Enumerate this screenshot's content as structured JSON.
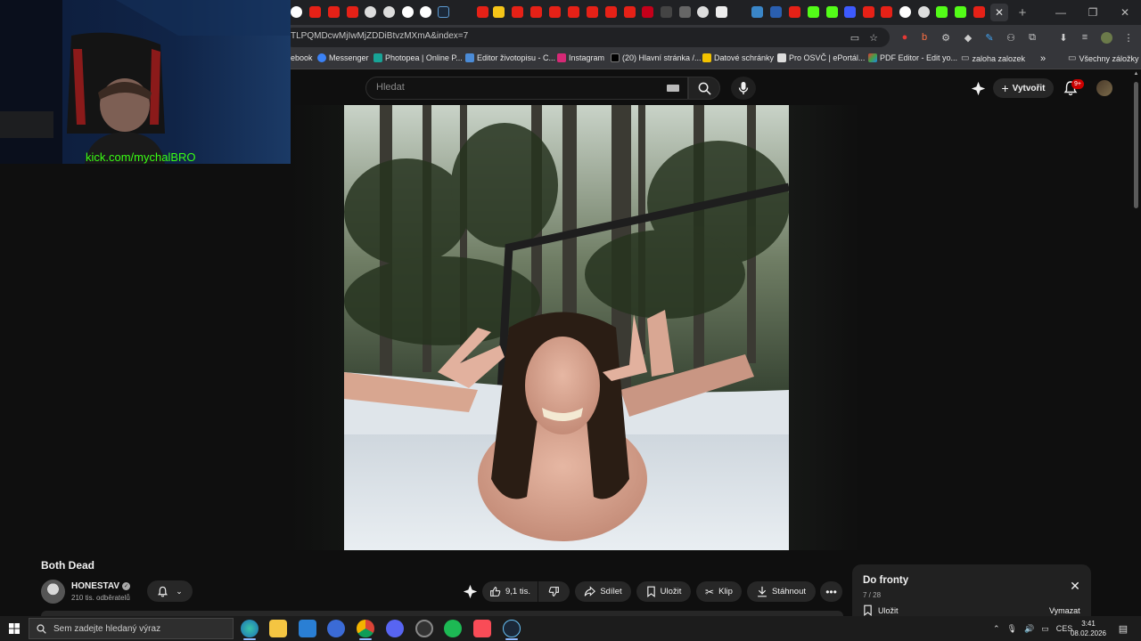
{
  "browser": {
    "url": "TLPQMDcwMjIwMjZDDiBtvzMXmA&index=7",
    "bookmarks": [
      {
        "label": "ebook"
      },
      {
        "label": "Messenger"
      },
      {
        "label": "Photopea | Online P..."
      },
      {
        "label": "Editor životopisu - C..."
      },
      {
        "label": "Instagram"
      },
      {
        "label": "(20) Hlavní stránka /..."
      },
      {
        "label": "Datové schránky"
      },
      {
        "label": "Pro OSVČ | ePortál..."
      },
      {
        "label": "PDF Editor - Edit yo..."
      },
      {
        "label": "zaloha zalozek"
      }
    ],
    "bookmarks_more": "»",
    "all_bookmarks": "Všechny záložky"
  },
  "youtube": {
    "search_placeholder": "Hledat",
    "create_label": "Vytvořit",
    "notifications_badge": "9+",
    "video": {
      "title": "Both Dead",
      "channel_name": "HONESTAV",
      "channel_subs": "210 tis. odběratelů",
      "likes": "9,1 tis.",
      "share_label": "Sdílet",
      "save_label": "Uložit",
      "clip_label": "Klip",
      "download_label": "Stáhnout"
    },
    "queue": {
      "title": "Do fronty",
      "count": "7 / 28",
      "save_label": "Uložit",
      "clear_label": "Vymazat"
    }
  },
  "stream_overlay": {
    "link": "kick.com/mychalBRO"
  },
  "taskbar": {
    "search_placeholder": "Sem zadejte hledaný výraz",
    "language": "CES",
    "time": "3:41",
    "date": "08.02.2026"
  },
  "colors": {
    "yt_bg": "#0f0f0f",
    "chip": "#272727",
    "overlay_green": "#39ff14",
    "badge_red": "#cc0000"
  }
}
